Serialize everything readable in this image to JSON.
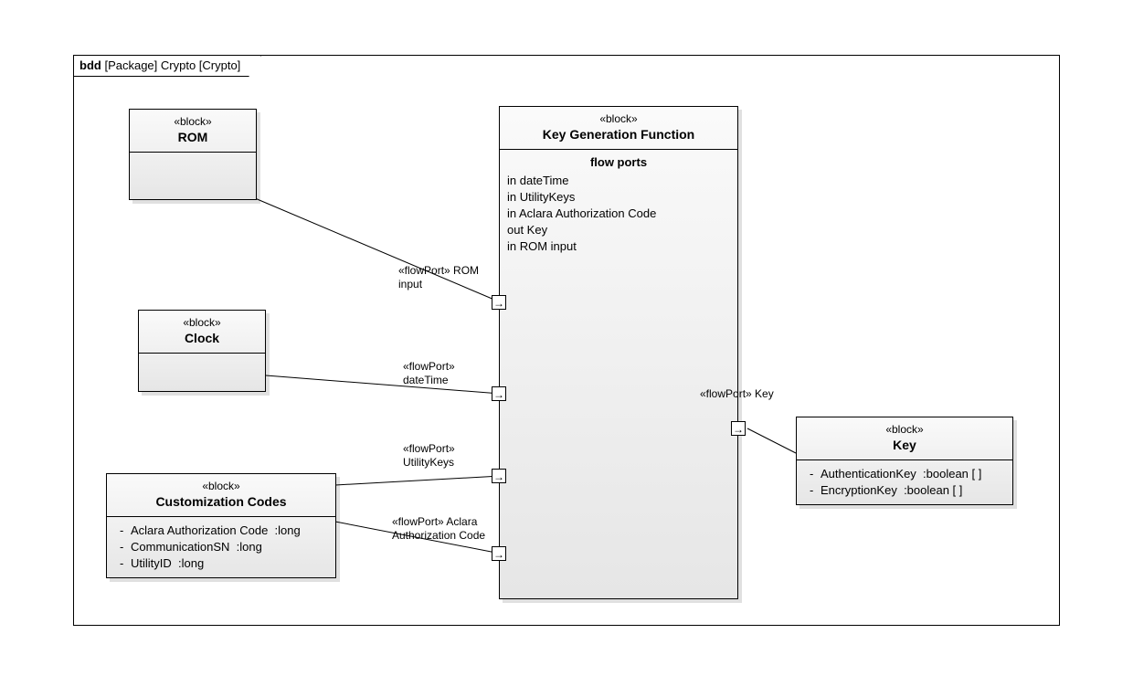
{
  "frame": {
    "prefix": "bdd",
    "scope": "[Package] Crypto [Crypto]"
  },
  "blocks": {
    "rom": {
      "stereo": "«block»",
      "name": "ROM"
    },
    "clock": {
      "stereo": "«block»",
      "name": "Clock"
    },
    "cust": {
      "stereo": "«block»",
      "name": "Customization Codes",
      "attrs": [
        {
          "name": "Aclara Authorization Code",
          "type": ":long"
        },
        {
          "name": "CommunicationSN",
          "type": ":long"
        },
        {
          "name": "UtilityID",
          "type": ":long"
        }
      ]
    },
    "kgf": {
      "stereo": "«block»",
      "name": "Key Generation Function",
      "section": "flow  ports",
      "ports": [
        "in dateTime",
        "in UtilityKeys",
        "in Aclara Authorization Code",
        "out Key",
        "in ROM input"
      ]
    },
    "key": {
      "stereo": "«block»",
      "name": "Key",
      "attrs": [
        {
          "name": "AuthenticationKey",
          "type": ":boolean [ ]"
        },
        {
          "name": "EncryptionKey",
          "type": ":boolean [ ]"
        }
      ]
    }
  },
  "portLabels": {
    "romInput": "«flowPort» ROM\ninput",
    "dateTime": "«flowPort»\ndateTime",
    "utilityKeys": "«flowPort»\nUtilityKeys",
    "aclara": "«flowPort» Aclara\nAuthorization Code",
    "key": "«flowPort» Key"
  }
}
